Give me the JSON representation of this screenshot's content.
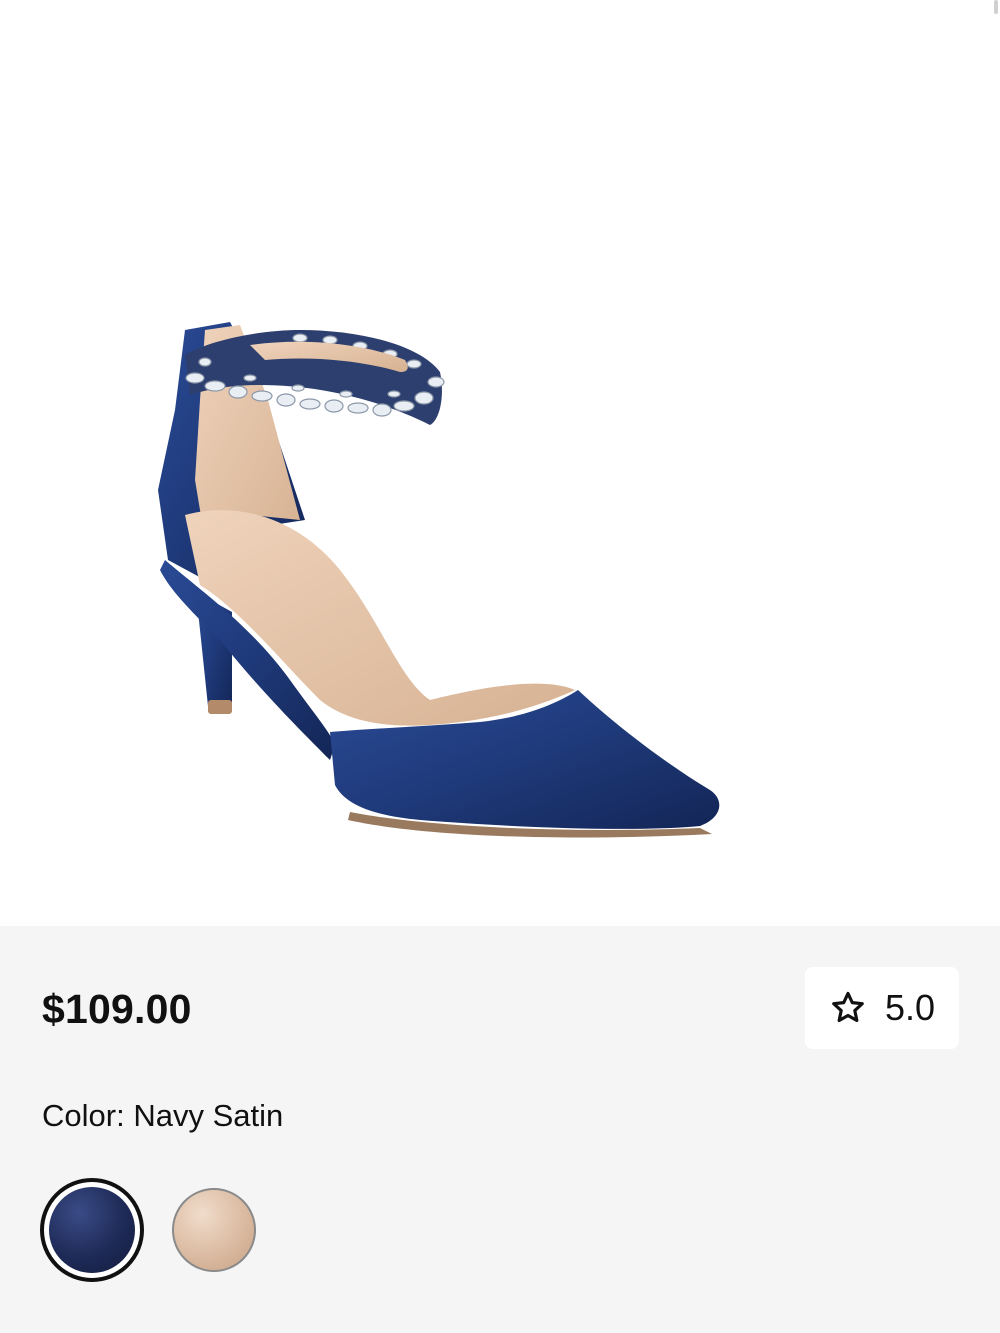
{
  "product": {
    "image_alt": "Navy satin pointed-toe pump with crystal ankle strap",
    "price": "$109.00",
    "rating": {
      "icon": "star-outline-icon",
      "value": "5.0"
    },
    "color": {
      "label": "Color:",
      "selected": "Navy Satin"
    },
    "swatches": [
      {
        "name": "Navy Satin",
        "color": "#1e2a57",
        "selected": true
      },
      {
        "name": "Champagne",
        "color": "#d9b89e",
        "selected": false
      }
    ]
  },
  "colors": {
    "panel_background": "#f5f5f5",
    "text": "#111111",
    "shoe_navy": "#1f3a7a",
    "lining_nude": "#e3c2a4"
  }
}
